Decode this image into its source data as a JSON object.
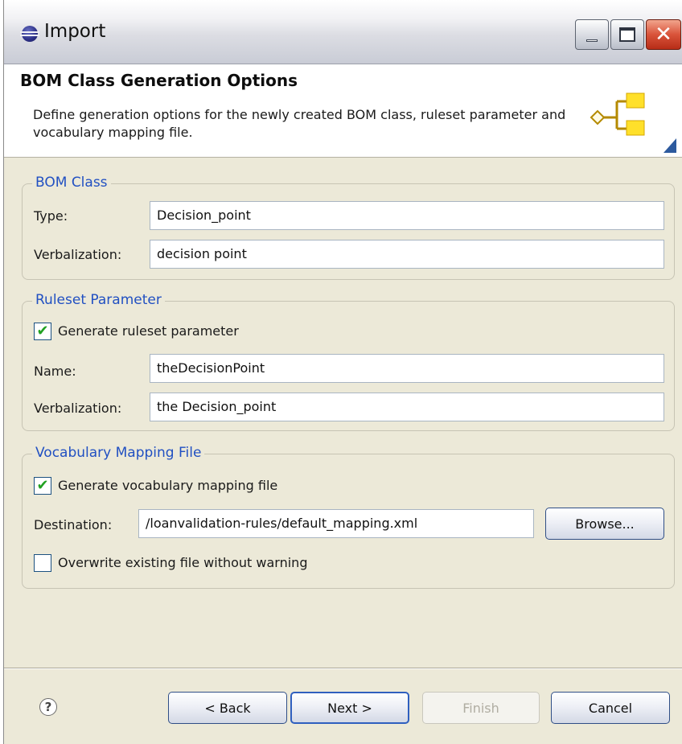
{
  "window": {
    "title": "Import",
    "minimize_icon": "minimize-icon",
    "maximize_icon": "maximize-icon",
    "close_icon": "close-icon"
  },
  "header": {
    "title": "BOM Class Generation Options",
    "description": "Define generation options for the newly created BOM class, ruleset parameter and vocabulary mapping file.",
    "graphic_icon": "class-hierarchy-icon"
  },
  "bom_class": {
    "legend": "BOM Class",
    "type_label": "Type:",
    "type_value": "Decision_point",
    "verbalization_label": "Verbalization:",
    "verbalization_value": "decision point"
  },
  "ruleset_parameter": {
    "legend": "Ruleset Parameter",
    "generate_label": "Generate ruleset parameter",
    "generate_checked": true,
    "name_label": "Name:",
    "name_value": "theDecisionPoint",
    "verbalization_label": "Verbalization:",
    "verbalization_value": "the Decision_point"
  },
  "vocabulary_mapping": {
    "legend": "Vocabulary Mapping File",
    "generate_label": "Generate vocabulary mapping file",
    "generate_checked": true,
    "destination_label": "Destination:",
    "destination_value": "/loanvalidation-rules/default_mapping.xml",
    "browse_label": "Browse...",
    "overwrite_label": "Overwrite existing file without warning",
    "overwrite_checked": false
  },
  "footer": {
    "help_icon": "help-icon",
    "back_label": "< Back",
    "next_label": "Next >",
    "finish_label": "Finish",
    "cancel_label": "Cancel"
  },
  "colors": {
    "dialog_bg": "#ece9d8",
    "group_legend": "#2150c2",
    "check_mark": "#21a121",
    "close_button": "#d9533a"
  }
}
